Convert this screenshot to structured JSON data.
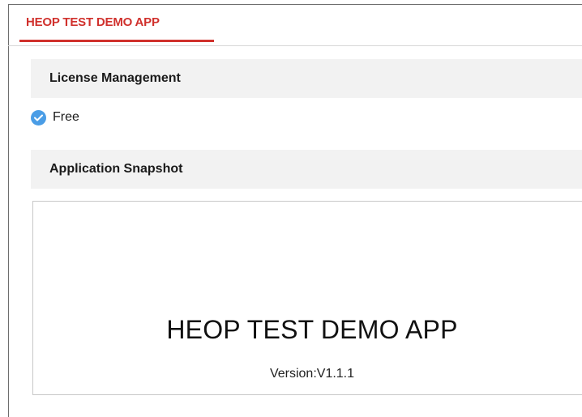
{
  "tab": {
    "label": "HEOP TEST DEMO APP",
    "accent_color": "#d0312d"
  },
  "license_section": {
    "title": "License Management",
    "status_icon": "check-circle-icon",
    "status_label": "Free"
  },
  "snapshot_section": {
    "title": "Application Snapshot",
    "app_name": "HEOP TEST DEMO APP",
    "version": "Version:V1.1.1"
  }
}
